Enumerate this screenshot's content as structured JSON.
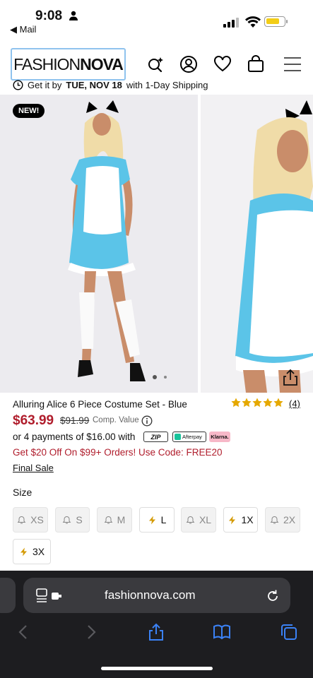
{
  "status_bar": {
    "time": "9:08",
    "back_label": "◀ Mail"
  },
  "header": {
    "logo_thin": "FASHION",
    "logo_bold": "NOVA",
    "shipping": {
      "prefix": "Get it by",
      "date": "TUE, NOV 18",
      "suffix": "with 1-Day Shipping"
    }
  },
  "gallery": {
    "badge": "NEW!",
    "current_image": 1,
    "image_count": 2
  },
  "product": {
    "title": "Alluring Alice 6 Piece Costume Set - Blue",
    "rating": 5,
    "rating_count": "(4)",
    "price": "$63.99",
    "compare_price": "$91.99",
    "compare_label": "Comp. Value",
    "installments": "or 4 payments of $16.00 with",
    "pay_zip": "ZIP",
    "pay_afterpay": "Afterpay",
    "pay_klarna": "Klarna.",
    "promo": "Get $20 Off On $99+ Orders! Use Code: FREE20",
    "final_sale": "Final Sale"
  },
  "size": {
    "label": "Size",
    "options": [
      {
        "label": "XS",
        "available": false
      },
      {
        "label": "S",
        "available": false
      },
      {
        "label": "M",
        "available": false
      },
      {
        "label": "L",
        "available": true
      },
      {
        "label": "XL",
        "available": false
      },
      {
        "label": "1X",
        "available": true
      },
      {
        "label": "2X",
        "available": false
      },
      {
        "label": "3X",
        "available": true
      }
    ]
  },
  "browser": {
    "url": "fashionnova.com"
  },
  "colors": {
    "price_red": "#b01d2c",
    "star_gold": "#e5a800",
    "safari_blue": "#3b82f6",
    "dress_blue": "#5bc4e8"
  }
}
